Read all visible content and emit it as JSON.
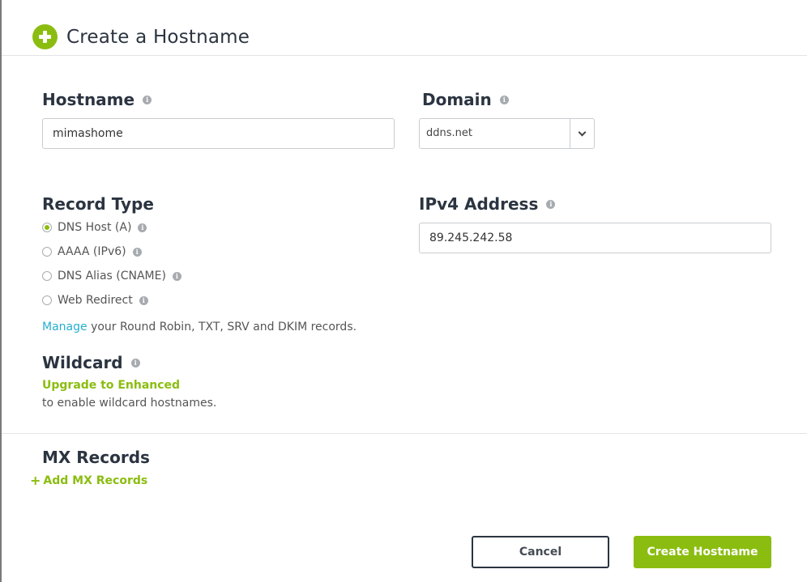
{
  "modal": {
    "title": "Create a Hostname",
    "title_icon": "plus-circle-icon"
  },
  "hostname": {
    "label": "Hostname",
    "value": "mimashome"
  },
  "domain": {
    "label": "Domain",
    "selected": "ddns.net"
  },
  "record_type": {
    "label": "Record Type",
    "options": [
      {
        "label": "DNS Host (A)",
        "checked": true
      },
      {
        "label": "AAAA (IPv6)",
        "checked": false
      },
      {
        "label": "DNS Alias (CNAME)",
        "checked": false
      },
      {
        "label": "Web Redirect",
        "checked": false
      }
    ],
    "manage_link": "Manage",
    "manage_text": " your Round Robin, TXT, SRV and DKIM records."
  },
  "ipv4": {
    "label": "IPv4 Address",
    "value": "89.245.242.58"
  },
  "wildcard": {
    "label": "Wildcard",
    "upgrade_link": "Upgrade to Enhanced",
    "upgrade_text": "to enable wildcard hostnames."
  },
  "mx": {
    "label": "MX Records",
    "add_link": "Add MX Records"
  },
  "info_glyph": "i",
  "buttons": {
    "cancel": "Cancel",
    "create": "Create Hostname"
  },
  "colors": {
    "accent_green": "#8bbd10",
    "link_blue": "#26aed0",
    "heading": "#2b3440"
  }
}
